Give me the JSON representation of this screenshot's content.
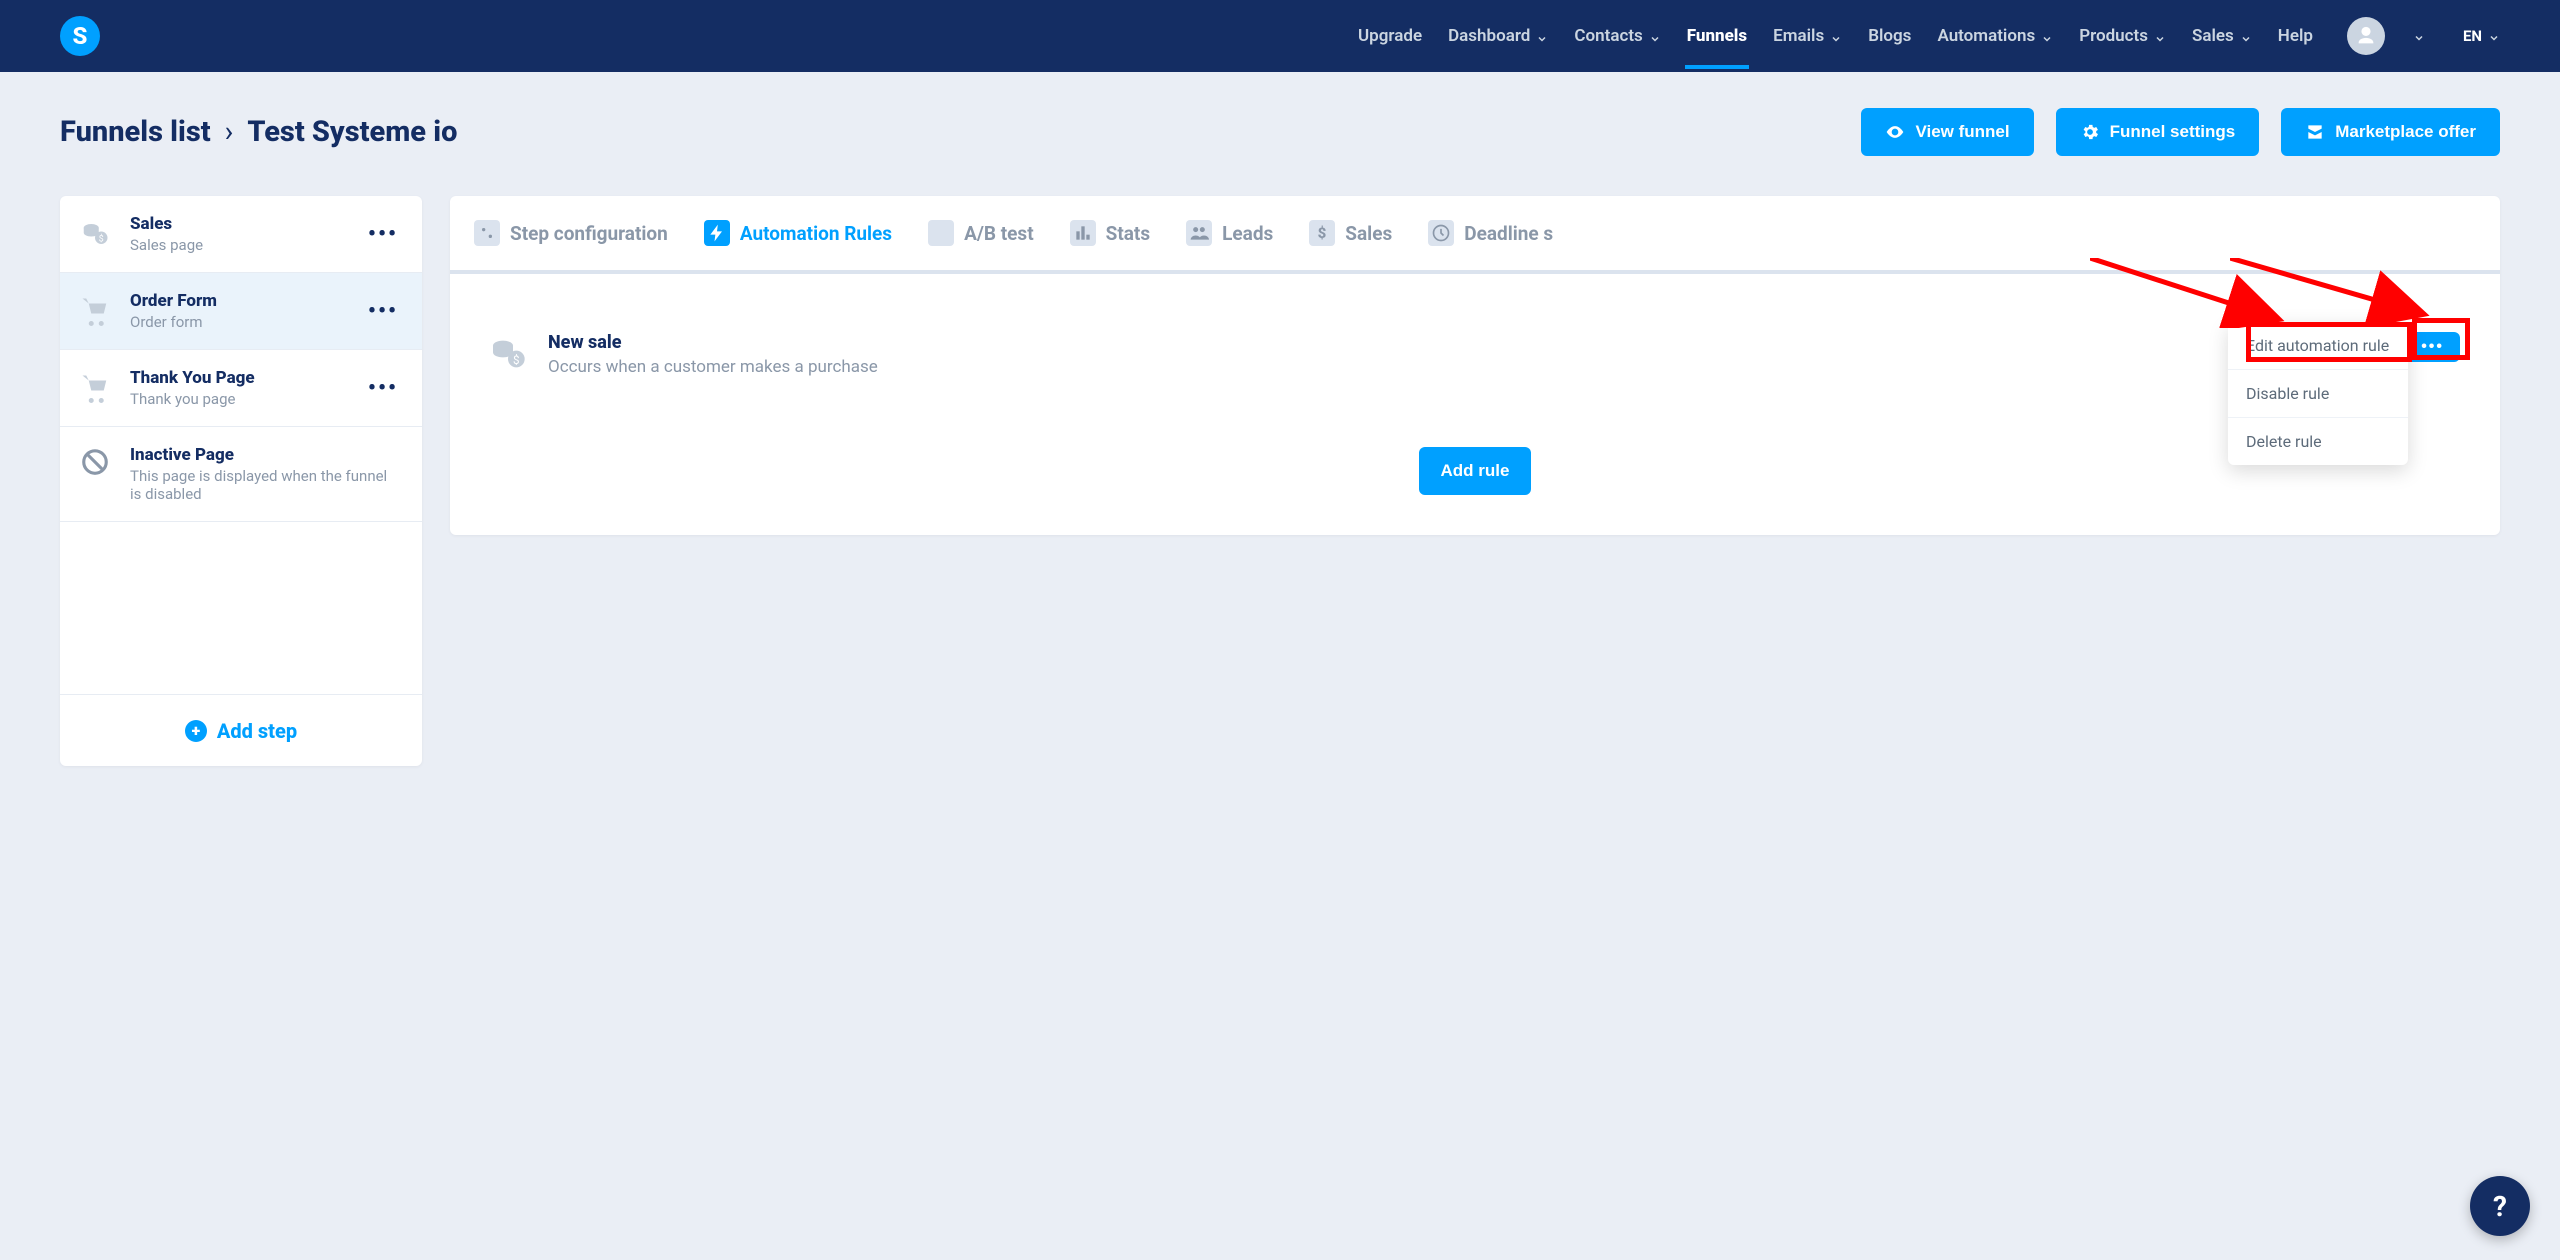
{
  "logo_letter": "S",
  "nav": {
    "upgrade": "Upgrade",
    "dashboard": "Dashboard",
    "contacts": "Contacts",
    "funnels": "Funnels",
    "emails": "Emails",
    "blogs": "Blogs",
    "automations": "Automations",
    "products": "Products",
    "sales": "Sales",
    "help": "Help",
    "lang": "EN"
  },
  "breadcrumb": {
    "root": "Funnels list",
    "current": "Test Systeme io"
  },
  "head_buttons": {
    "view": "View funnel",
    "settings": "Funnel settings",
    "marketplace": "Marketplace offer"
  },
  "steps": [
    {
      "title": "Sales",
      "sub": "Sales page",
      "icon": "coins"
    },
    {
      "title": "Order Form",
      "sub": "Order form",
      "icon": "cart",
      "active": true
    },
    {
      "title": "Thank You Page",
      "sub": "Thank you page",
      "icon": "cart"
    }
  ],
  "inactive_step": {
    "title": "Inactive Page",
    "sub": "This page is displayed when the funnel is disabled"
  },
  "add_step": "Add step",
  "tabs": {
    "step_config": "Step configuration",
    "automation": "Automation Rules",
    "ab": "A/B test",
    "stats": "Stats",
    "leads": "Leads",
    "sales": "Sales",
    "deadline": "Deadline s"
  },
  "rule": {
    "title": "New sale",
    "sub": "Occurs when a customer makes a purchase"
  },
  "rule_menu": {
    "edit": "Edit automation rule",
    "disable": "Disable rule",
    "delete": "Delete rule"
  },
  "add_rule": "Add rule",
  "help": "?"
}
